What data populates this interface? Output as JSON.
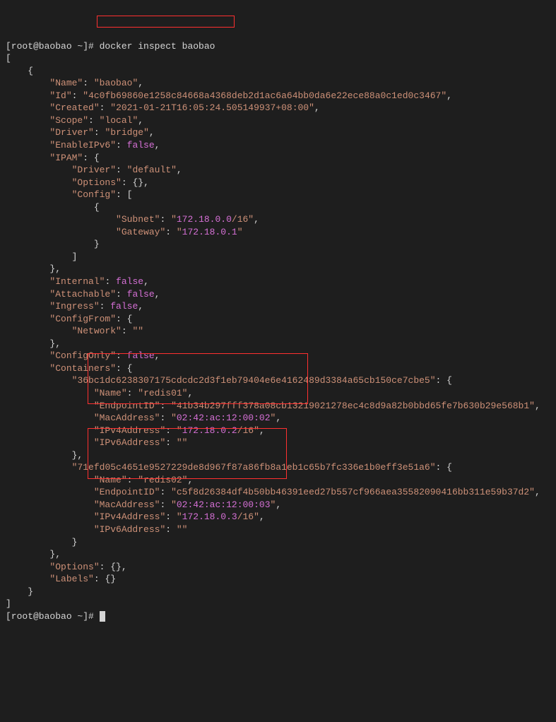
{
  "prompt": "[root@baobao ~]# ",
  "command": "docker inspect baobao",
  "output": {
    "Name": "baobao",
    "Id": "4c0fb69860e1258c84668a4368deb2d1ac6a64bb0da6e22ece88a0c1ed0c3467",
    "Created": "2021-01-21T16:05:24.505149937+08:00",
    "Scope": "local",
    "Driver": "bridge",
    "EnableIPv6": "false",
    "IPAM": {
      "Driver": "default",
      "Options": "{}",
      "Config": {
        "Subnet_prefix": "172.18.0.0",
        "Subnet_suffix": "/16",
        "Gateway": "172.18.0.1"
      }
    },
    "Internal": "false",
    "Attachable": "false",
    "Ingress": "false",
    "ConfigFrom": {
      "Network": ""
    },
    "ConfigOnly": "false",
    "Containers": {
      "c1_hash": "36bc1dc6238307175cdcdc2d3f1eb79404e6e4162489d3384a65cb150ce7cbe5",
      "c1": {
        "Name": "redis01",
        "EndpointID": "41b34b297fff378a08cb13219021278ec4c8d9a82b0bbd65fe7b630b29e568b1",
        "MacAddress": "02:42:ac:12:00:02",
        "IPv4Address_prefix": "172.18.0.2",
        "IPv4Address_suffix": "/16",
        "IPv6Address": ""
      },
      "c2_hash": "71efd05c4651e9527229de8d967f87a86fb8a1eb1c65b7fc336e1b0eff3e51a6",
      "c2": {
        "Name": "redis02",
        "EndpointID": "c5f8d26384df4b50bb46391eed27b557cf966aea35582090416bb311e59b37d2",
        "MacAddress": "02:42:ac:12:00:03",
        "IPv4Address_prefix": "172.18.0.3",
        "IPv4Address_suffix": "/16",
        "IPv6Address": ""
      }
    },
    "Options": "{}",
    "Labels": "{}"
  },
  "final_prompt": "[root@baobao ~]# "
}
